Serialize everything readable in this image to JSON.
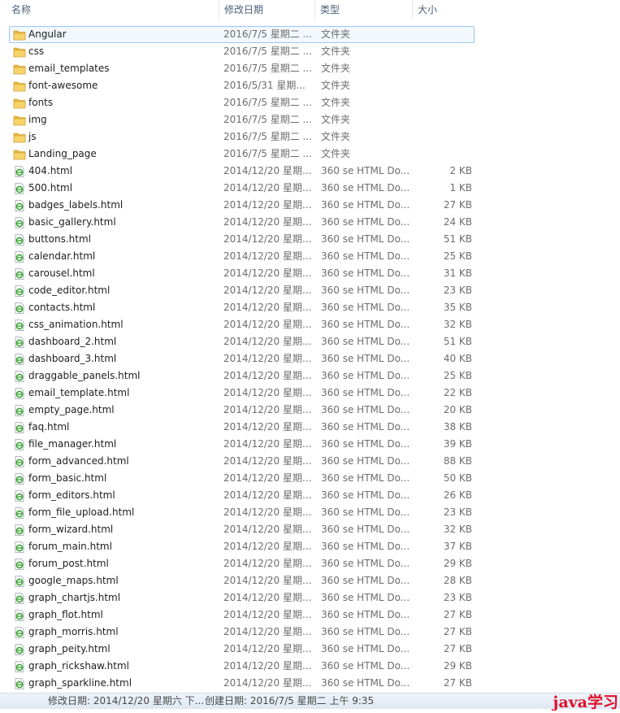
{
  "columns": {
    "name": "名称",
    "date": "修改日期",
    "type": "类型",
    "size": "大小"
  },
  "files": [
    {
      "name": "Angular",
      "date": "2016/7/5 星期二 ...",
      "type": "文件夹",
      "size": "",
      "icon": "folder-icon",
      "selected": true
    },
    {
      "name": "css",
      "date": "2016/7/5 星期二 ...",
      "type": "文件夹",
      "size": "",
      "icon": "folder-icon"
    },
    {
      "name": "email_templates",
      "date": "2016/7/5 星期二 ...",
      "type": "文件夹",
      "size": "",
      "icon": "folder-icon"
    },
    {
      "name": "font-awesome",
      "date": "2016/5/31 星期...",
      "type": "文件夹",
      "size": "",
      "icon": "folder-icon"
    },
    {
      "name": "fonts",
      "date": "2016/7/5 星期二 ...",
      "type": "文件夹",
      "size": "",
      "icon": "folder-icon"
    },
    {
      "name": "img",
      "date": "2016/7/5 星期二 ...",
      "type": "文件夹",
      "size": "",
      "icon": "folder-icon"
    },
    {
      "name": "js",
      "date": "2016/7/5 星期二 ...",
      "type": "文件夹",
      "size": "",
      "icon": "folder-icon"
    },
    {
      "name": "Landing_page",
      "date": "2016/7/5 星期二 ...",
      "type": "文件夹",
      "size": "",
      "icon": "folder-icon"
    },
    {
      "name": "404.html",
      "date": "2014/12/20 星期...",
      "type": "360 se HTML Do...",
      "size": "2 KB",
      "icon": "html-file-icon"
    },
    {
      "name": "500.html",
      "date": "2014/12/20 星期...",
      "type": "360 se HTML Do...",
      "size": "1 KB",
      "icon": "html-file-icon"
    },
    {
      "name": "badges_labels.html",
      "date": "2014/12/20 星期...",
      "type": "360 se HTML Do...",
      "size": "27 KB",
      "icon": "html-file-icon"
    },
    {
      "name": "basic_gallery.html",
      "date": "2014/12/20 星期...",
      "type": "360 se HTML Do...",
      "size": "24 KB",
      "icon": "html-file-icon"
    },
    {
      "name": "buttons.html",
      "date": "2014/12/20 星期...",
      "type": "360 se HTML Do...",
      "size": "51 KB",
      "icon": "html-file-icon"
    },
    {
      "name": "calendar.html",
      "date": "2014/12/20 星期...",
      "type": "360 se HTML Do...",
      "size": "25 KB",
      "icon": "html-file-icon"
    },
    {
      "name": "carousel.html",
      "date": "2014/12/20 星期...",
      "type": "360 se HTML Do...",
      "size": "31 KB",
      "icon": "html-file-icon"
    },
    {
      "name": "code_editor.html",
      "date": "2014/12/20 星期...",
      "type": "360 se HTML Do...",
      "size": "23 KB",
      "icon": "html-file-icon"
    },
    {
      "name": "contacts.html",
      "date": "2014/12/20 星期...",
      "type": "360 se HTML Do...",
      "size": "35 KB",
      "icon": "html-file-icon"
    },
    {
      "name": "css_animation.html",
      "date": "2014/12/20 星期...",
      "type": "360 se HTML Do...",
      "size": "32 KB",
      "icon": "html-file-icon"
    },
    {
      "name": "dashboard_2.html",
      "date": "2014/12/20 星期...",
      "type": "360 se HTML Do...",
      "size": "51 KB",
      "icon": "html-file-icon"
    },
    {
      "name": "dashboard_3.html",
      "date": "2014/12/20 星期...",
      "type": "360 se HTML Do...",
      "size": "40 KB",
      "icon": "html-file-icon"
    },
    {
      "name": "draggable_panels.html",
      "date": "2014/12/20 星期...",
      "type": "360 se HTML Do...",
      "size": "25 KB",
      "icon": "html-file-icon"
    },
    {
      "name": "email_template.html",
      "date": "2014/12/20 星期...",
      "type": "360 se HTML Do...",
      "size": "22 KB",
      "icon": "html-file-icon"
    },
    {
      "name": "empty_page.html",
      "date": "2014/12/20 星期...",
      "type": "360 se HTML Do...",
      "size": "20 KB",
      "icon": "html-file-icon"
    },
    {
      "name": "faq.html",
      "date": "2014/12/20 星期...",
      "type": "360 se HTML Do...",
      "size": "38 KB",
      "icon": "html-file-icon"
    },
    {
      "name": "file_manager.html",
      "date": "2014/12/20 星期...",
      "type": "360 se HTML Do...",
      "size": "39 KB",
      "icon": "html-file-icon"
    },
    {
      "name": "form_advanced.html",
      "date": "2014/12/20 星期...",
      "type": "360 se HTML Do...",
      "size": "88 KB",
      "icon": "html-file-icon"
    },
    {
      "name": "form_basic.html",
      "date": "2014/12/20 星期...",
      "type": "360 se HTML Do...",
      "size": "50 KB",
      "icon": "html-file-icon"
    },
    {
      "name": "form_editors.html",
      "date": "2014/12/20 星期...",
      "type": "360 se HTML Do...",
      "size": "26 KB",
      "icon": "html-file-icon"
    },
    {
      "name": "form_file_upload.html",
      "date": "2014/12/20 星期...",
      "type": "360 se HTML Do...",
      "size": "23 KB",
      "icon": "html-file-icon"
    },
    {
      "name": "form_wizard.html",
      "date": "2014/12/20 星期...",
      "type": "360 se HTML Do...",
      "size": "32 KB",
      "icon": "html-file-icon"
    },
    {
      "name": "forum_main.html",
      "date": "2014/12/20 星期...",
      "type": "360 se HTML Do...",
      "size": "37 KB",
      "icon": "html-file-icon"
    },
    {
      "name": "forum_post.html",
      "date": "2014/12/20 星期...",
      "type": "360 se HTML Do...",
      "size": "29 KB",
      "icon": "html-file-icon"
    },
    {
      "name": "google_maps.html",
      "date": "2014/12/20 星期...",
      "type": "360 se HTML Do...",
      "size": "28 KB",
      "icon": "html-file-icon"
    },
    {
      "name": "graph_chartjs.html",
      "date": "2014/12/20 星期...",
      "type": "360 se HTML Do...",
      "size": "23 KB",
      "icon": "html-file-icon"
    },
    {
      "name": "graph_flot.html",
      "date": "2014/12/20 星期...",
      "type": "360 se HTML Do...",
      "size": "27 KB",
      "icon": "html-file-icon"
    },
    {
      "name": "graph_morris.html",
      "date": "2014/12/20 星期...",
      "type": "360 se HTML Do...",
      "size": "27 KB",
      "icon": "html-file-icon"
    },
    {
      "name": "graph_peity.html",
      "date": "2014/12/20 星期...",
      "type": "360 se HTML Do...",
      "size": "27 KB",
      "icon": "html-file-icon"
    },
    {
      "name": "graph_rickshaw.html",
      "date": "2014/12/20 星期...",
      "type": "360 se HTML Do...",
      "size": "29 KB",
      "icon": "html-file-icon"
    },
    {
      "name": "graph_sparkline.html",
      "date": "2014/12/20 星期...",
      "type": "360 se HTML Do...",
      "size": "27 KB",
      "icon": "html-file-icon"
    }
  ],
  "status": {
    "modified": "修改日期: 2014/12/20 星期六 下...",
    "created": "创建日期: 2016/7/5 星期二 上午 9:35"
  },
  "watermark": "java学习",
  "colors": {
    "selection_bg": "#f2f8fe",
    "selection_border": "#99c9ef",
    "folder": "#e8b93c",
    "html_icon_accent": "#3aa534",
    "watermark": "#e0102a"
  }
}
